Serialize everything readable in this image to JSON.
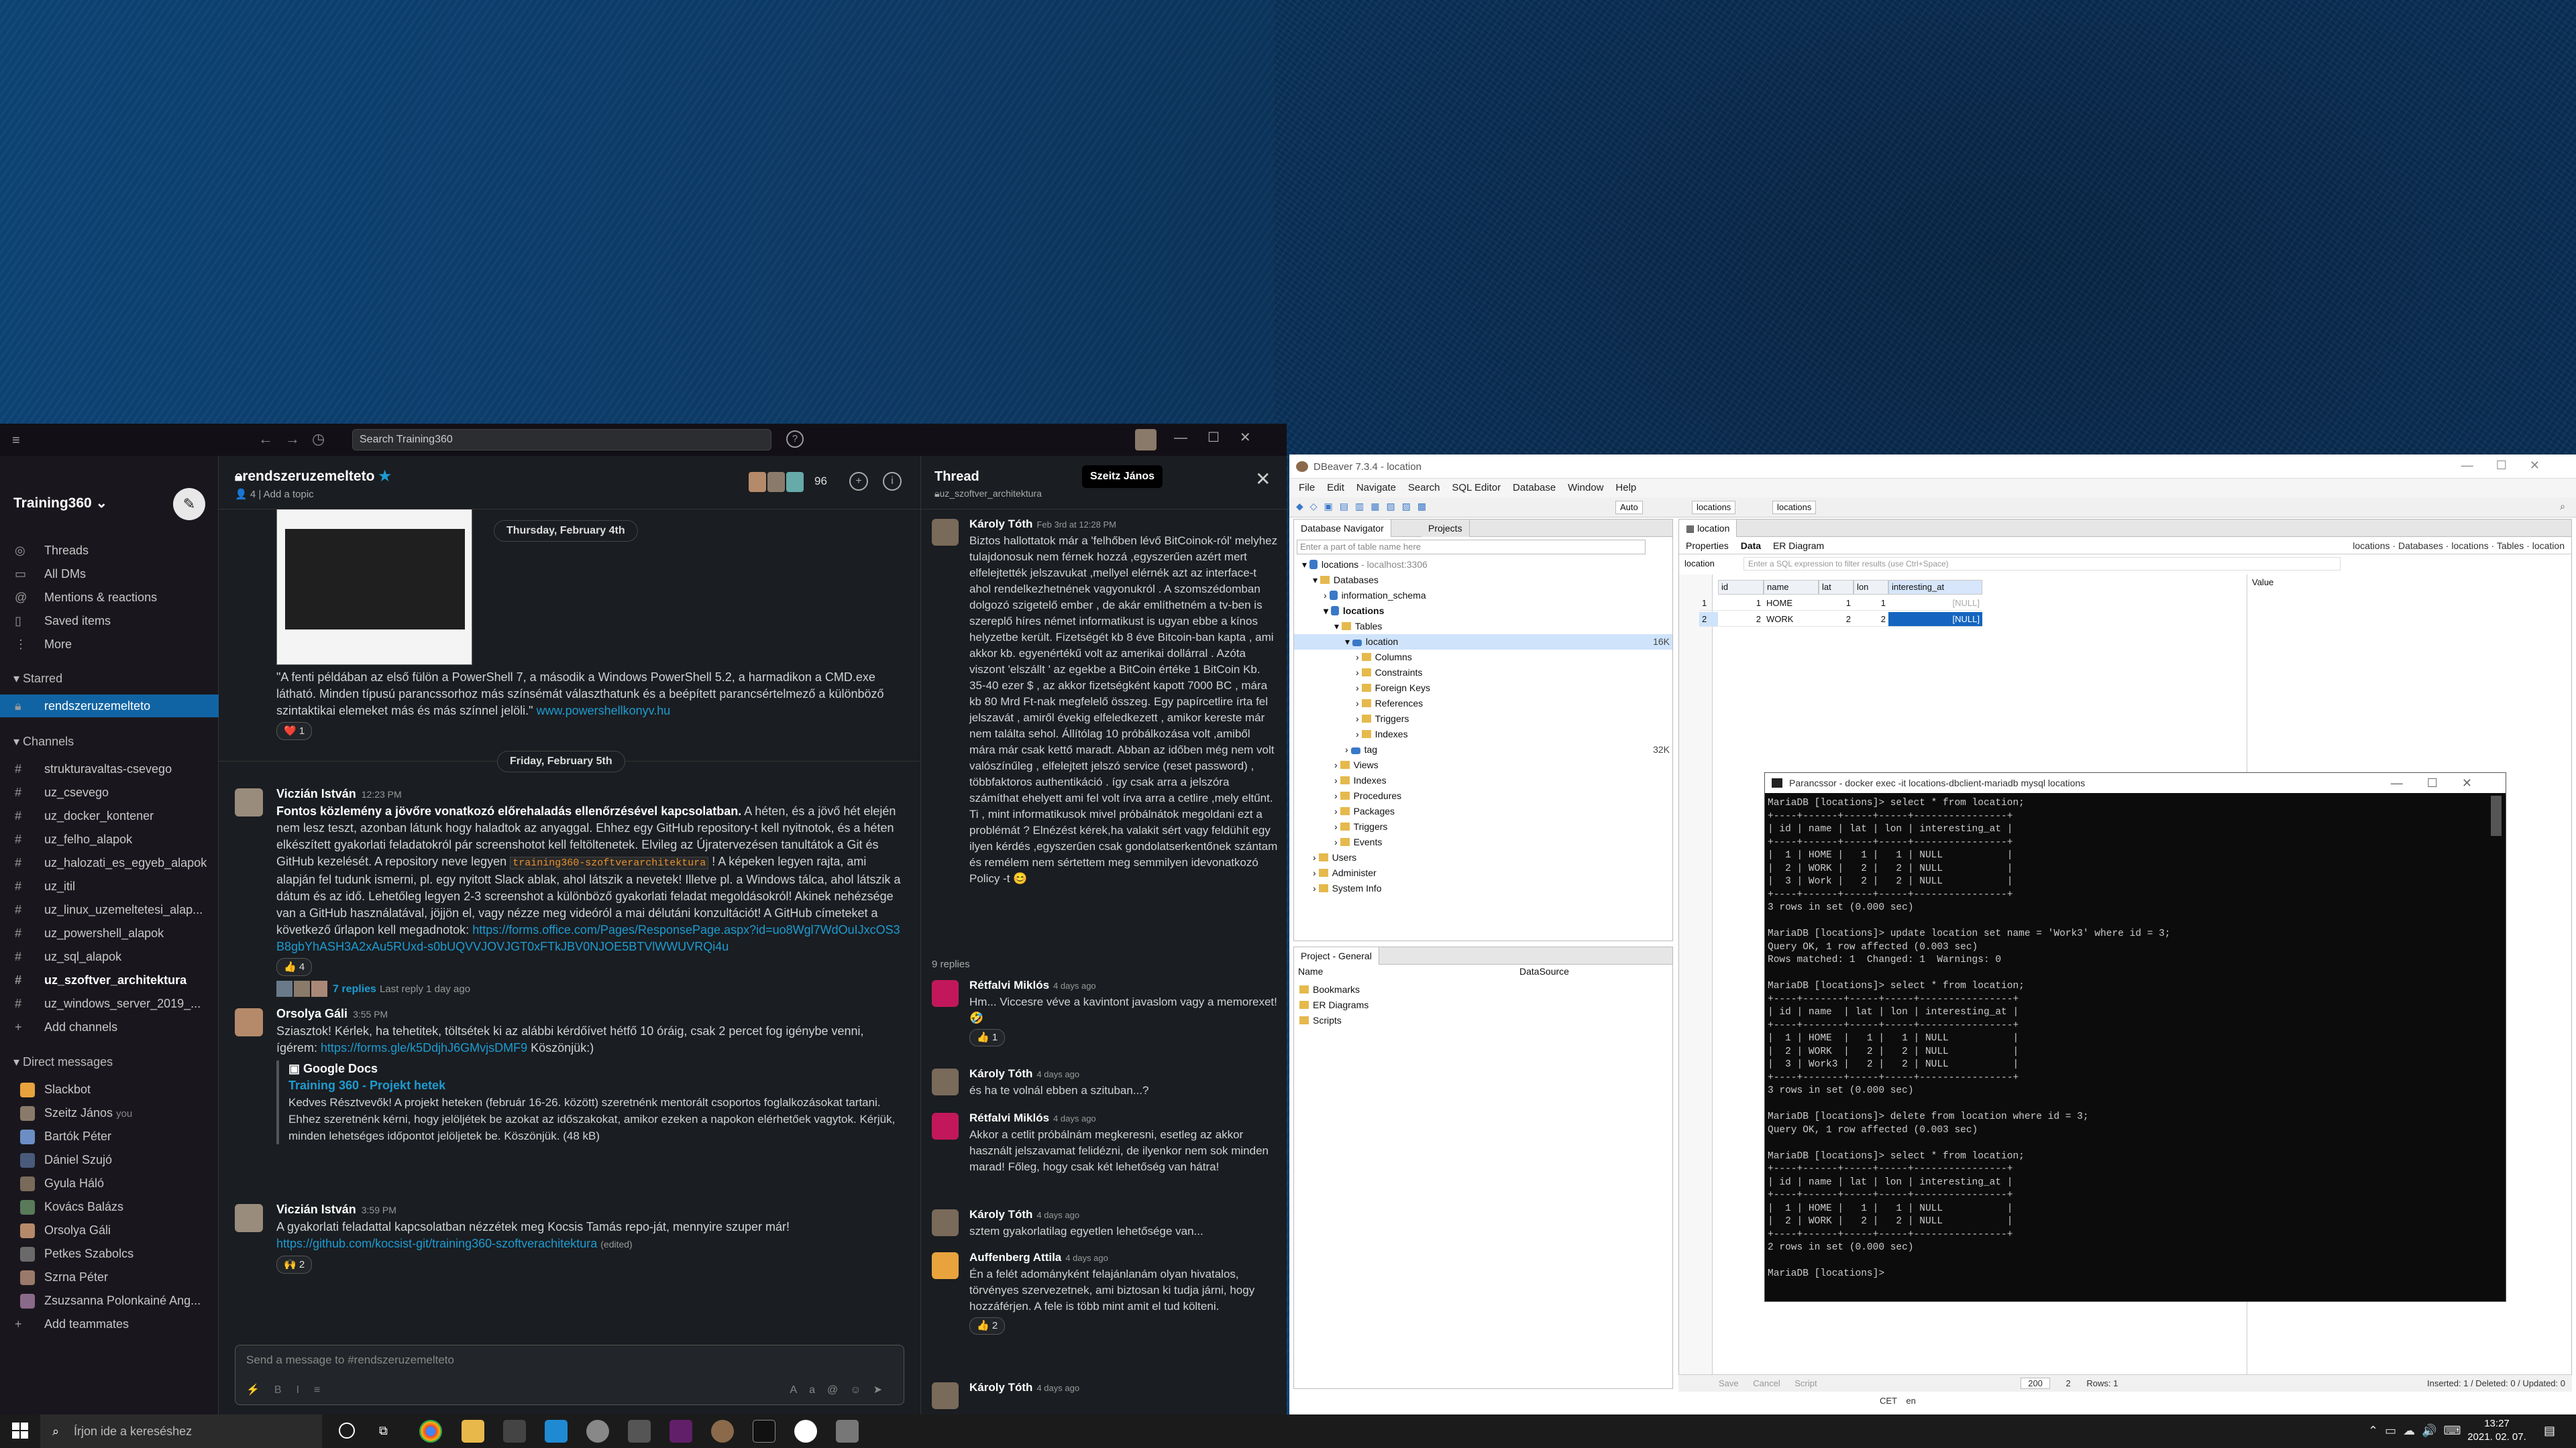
{
  "slack": {
    "search_placeholder": "Search Training360",
    "workspace": "Training360",
    "nav": [
      "Threads",
      "All DMs",
      "Mentions & reactions",
      "Saved items",
      "More"
    ],
    "starred_label": "Starred",
    "starred": [
      "rendszeruzemelteto"
    ],
    "channels_label": "Channels",
    "channels": [
      "strukturavaltas-csevego",
      "uz_csevego",
      "uz_docker_kontener",
      "uz_felho_alapok",
      "uz_halozati_es_egyeb_alapok",
      "uz_itil",
      "uz_linux_uzemeltetesi_alap...",
      "uz_powershell_alapok",
      "uz_sql_alapok",
      "uz_szoftver_architektura",
      "uz_windows_server_2019_..."
    ],
    "add_channels": "Add channels",
    "dm_label": "Direct messages",
    "dms": [
      "Slackbot",
      "Szeitz János",
      "Bartók Péter",
      "Dániel Szujó",
      "Gyula Háló",
      "Kovács Balázs",
      "Orsolya Gáli",
      "Petkes Szabolcs",
      "Szrna Péter",
      "Zsuzsanna Polonkainé Ang..."
    ],
    "dm_you": "you",
    "add_teammates": "Add teammates",
    "channel": {
      "name": "rendszeruzemelteto",
      "members_count_short": "4",
      "add_topic": "Add a topic",
      "member_count": "96",
      "date1": "Thursday, February 4th",
      "date2": "Friday, February 5th",
      "msg0_text": "\"A fenti példában az első fülön a PowerShell 7, a második a Windows PowerShell 5.2, a harmadikon a CMD.exe látható. Minden típusú parancssorhoz más színsémát választhatunk és a beépített parancsértelmező a különböző szintaktikai elemeket más és más színnel jelöli.\"",
      "msg0_link": "www.powershellkonyv.hu",
      "msg0_react": "❤️ 1",
      "msg1_name": "Viczián István",
      "msg1_time": "12:23 PM",
      "msg1_bold": "Fontos közlemény a jövőre vonatkozó előrehaladás ellenőrzésével kapcsolatban.",
      "msg1_text": "A héten, és a jövő hét elején nem lesz teszt, azonban látunk hogy haladtok az anyaggal. Ehhez egy GitHub repository-t kell nyitnotok, és a héten elkészített gyakorlati feladatokról pár screenshotot kell feltöltenetek. Elvileg az Újratervezésen tanultátok a Git és GitHub kezelését. A repository neve legyen",
      "msg1_code": "training360-szoftverarchitektura",
      "msg1_text2": "! A képeken legyen rajta, ami alapján fel tudunk ismerni, pl. egy nyitott Slack ablak, ahol látszik a nevetek! Illetve pl. a Windows tálca, ahol látszik a dátum és az idő. Lehetőleg legyen 2-3 screenshot a különböző gyakorlati feladat megoldásokról! Akinek nehézsége van a GitHub használatával, jöjjön el, vagy nézze meg videóról a mai délutáni konzultációt! A GitHub címeteket a következő űrlapon kell megadnotok:",
      "msg1_link": "https://forms.office.com/Pages/ResponsePage.aspx?id=uo8Wgl7WdOuIJxcOS3B8gbYhASH3A2xAu5RUxd-s0bUQVVJOVJGT0xFTkJBV0NJOE5BTVlWWUVRQi4u",
      "msg1_react": "👍 4",
      "msg1_replies": "7 replies",
      "msg1_last": "Last reply 1 day ago",
      "msg2_name": "Orsolya Gáli",
      "msg2_time": "3:55 PM",
      "msg2_text": "Sziasztok! Kérlek, ha tehetitek, töltsétek ki az alábbi kérdőívet hétfő 10 óráig, csak 2 percet fog igénybe venni, ígérem:",
      "msg2_link": "https://forms.gle/k5DdjhJ6GMvjsDMF9",
      "msg2_text2": "Köszönjük:)",
      "gd_source": "Google Docs",
      "gd_title": "Training 360 - Projekt hetek",
      "gd_text": "Kedves Résztvevők! A projekt heteken (február 16-26. között) szeretnénk mentorált csoportos foglalkozásokat tartani. Ehhez szeretnénk kérni, hogy jelöljétek be azokat az időszakokat, amikor ezeken a napokon elérhetőek vagytok. Kérjük, minden lehetséges időpontot jelöljetek be. Köszönjük. (48 kB)",
      "msg3_name": "Viczián István",
      "msg3_time": "3:59 PM",
      "msg3_text": "A gyakorlati feladattal kapcsolatban nézzétek meg Kocsis Tamás repo-ját, mennyire szuper már!",
      "msg3_link": "https://github.com/kocsist-git/training360-szoftverachitektura",
      "msg3_edited": "(edited)",
      "msg3_react": "🙌 2",
      "composer_placeholder": "Send a message to #rendszeruzemelteto"
    },
    "thread": {
      "title": "Thread",
      "channel": "uz_szoftver_architektura",
      "tooltip": "Szeitz János",
      "m0_name": "Károly Tóth",
      "m0_time": "Feb 3rd at 12:28 PM",
      "m0_text": "Biztos hallottatok már a 'felhőben lévő BitCoinok-ról' melyhez tulajdonosuk nem férnek hozzá ,egyszerűen azért mert elfelejtették jelszavukat ,mellyel elérnék azt az interface-t ahol rendelkezhetnének vagyonukról . A szomszédomban dolgozó szigetelő ember , de akár említhetném a tv-ben is szereplő híres német informatikust is ugyan ebbe a kínos helyzetbe került. Fizetségét kb 8 éve Bitcoin-ban kapta , ami akkor kb. egyenértékű volt az amerikai dollárral . Azóta viszont 'elszállt ' az egekbe a BitCoin értéke 1 BitCoin Kb. 35-40 ezer $ , az akkor fizetségként kapott 7000 BC , mára kb 80 Mrd Ft-nak megfelelő összeg. Egy papírcetlire írta fel jelszavát , amiről évekig elfeledkezett , amikor kereste már nem találta sehol. Állítólag 10 próbálkozása volt ,amiből mára már csak kettő maradt. Abban az időben még nem volt valószínűleg , elfelejtett jelszó service (reset password) , többfaktoros authentikáció . így csak arra a jelszóra számíthat ehelyett ami fel volt írva arra a cetlire ,mely eltűnt. Ti , mint informatikusok mivel próbálnátok megoldani ezt a problémát ? Elnézést kérek,ha valakit sért vagy feldühít egy ilyen kérdés ,egyszerűen csak gondolatserkentőnek szántam és remélem nem sértettem meg semmilyen idevonatkozó Policy -t 😊",
      "replies_label": "9 replies",
      "m1_name": "Rétfalvi Miklós",
      "m1_time": "4 days ago",
      "m1_text": "Hm... Viccesre véve a kavintont javaslom vagy a memorexet! 🤣",
      "m1_react": "👍 1",
      "m2_name": "Károly Tóth",
      "m2_time": "4 days ago",
      "m2_text": "és ha te volnál ebben a szituban...?",
      "m3_name": "Rétfalvi Miklós",
      "m3_time": "4 days ago",
      "m3_text": "Akkor a cetlit próbálnám megkeresni, esetleg az akkor használt jelszavamat felidézni, de ilyenkor nem sok minden marad! Főleg, hogy csak két lehetőség van hátra!",
      "m4_name": "Károly Tóth",
      "m4_time": "4 days ago",
      "m4_text": "sztem gyakorlatilag egyetlen lehetősége van...",
      "m5_name": "Auffenberg Attila",
      "m5_time": "4 days ago",
      "m5_text": "Én a felét adományként felajánlanám olyan hivatalos, törvényes szervezetnek, ami biztosan ki tudja járni, hogy hozzáférjen. A fele is több mint amit el tud költeni.",
      "m5_react": "👍 2",
      "m6_name": "Károly Tóth",
      "m6_time": "4 days ago"
    }
  },
  "dbeaver": {
    "title": "DBeaver 7.3.4 - location",
    "menu": [
      "File",
      "Edit",
      "Navigate",
      "Search",
      "SQL Editor",
      "Database",
      "Window",
      "Help"
    ],
    "toolbar_mode": "Auto",
    "toolbar_db": "locations",
    "toolbar_schema": "locations",
    "nav_tab": "Database Navigator",
    "projects_tab": "Projects",
    "filter_placeholder": "Enter a part of table name here",
    "tree": [
      {
        "label": "locations",
        "extra": "- localhost:3306"
      },
      {
        "label": "Databases"
      },
      {
        "label": "information_schema"
      },
      {
        "label": "locations"
      },
      {
        "label": "Tables"
      },
      {
        "label": "location",
        "size": "16K"
      },
      {
        "label": "Columns"
      },
      {
        "label": "Constraints"
      },
      {
        "label": "Foreign Keys"
      },
      {
        "label": "References"
      },
      {
        "label": "Triggers"
      },
      {
        "label": "Indexes"
      },
      {
        "label": "tag",
        "size": "32K"
      },
      {
        "label": "Views"
      },
      {
        "label": "Indexes"
      },
      {
        "label": "Procedures"
      },
      {
        "label": "Packages"
      },
      {
        "label": "Triggers"
      },
      {
        "label": "Events"
      },
      {
        "label": "Users"
      },
      {
        "label": "Administer"
      },
      {
        "label": "System Info"
      }
    ],
    "project_title": "Project - General",
    "project_cols": [
      "Name",
      "DataSource"
    ],
    "project_items": [
      "Bookmarks",
      "ER Diagrams",
      "Scripts"
    ],
    "editor_tab": "location",
    "subtabs": [
      "Properties",
      "Data",
      "ER Diagram"
    ],
    "breadcrumb": [
      "locations",
      "Databases",
      "locations",
      "Tables",
      "location"
    ],
    "filter_hint": "Enter a SQL expression to filter results (use Ctrl+Space)",
    "grid_cols": [
      "id",
      "name",
      "lat",
      "lon",
      "interesting_at"
    ],
    "grid_rows": [
      [
        "1",
        "1",
        "HOME",
        "1",
        "1",
        "[NULL]"
      ],
      [
        "2",
        "2",
        "WORK",
        "2",
        "2",
        "[NULL]"
      ]
    ],
    "value_panel": "Value",
    "status": {
      "save": "Save",
      "cancel": "Cancel",
      "script": "Script",
      "limit": "200",
      "count": "2",
      "rows": "Rows: 1",
      "summary": "Inserted: 1 / Deleted: 0 / Updated: 0",
      "tz": "CET",
      "lang": "en"
    }
  },
  "terminal": {
    "title": "Parancssor - docker  exec -it locations-dbclient-mariadb mysql locations",
    "text": "MariaDB [locations]> select * from location;\n+----+------+-----+-----+----------------+\n| id | name | lat | lon | interesting_at |\n+----+------+-----+-----+----------------+\n|  1 | HOME |   1 |   1 | NULL           |\n|  2 | WORK |   2 |   2 | NULL           |\n|  3 | Work |   2 |   2 | NULL           |\n+----+------+-----+-----+----------------+\n3 rows in set (0.000 sec)\n\nMariaDB [locations]> update location set name = 'Work3' where id = 3;\nQuery OK, 1 row affected (0.003 sec)\nRows matched: 1  Changed: 1  Warnings: 0\n\nMariaDB [locations]> select * from location;\n+----+-------+-----+-----+----------------+\n| id | name  | lat | lon | interesting_at |\n+----+-------+-----+-----+----------------+\n|  1 | HOME  |   1 |   1 | NULL           |\n|  2 | WORK  |   2 |   2 | NULL           |\n|  3 | Work3 |   2 |   2 | NULL           |\n+----+-------+-----+-----+----------------+\n3 rows in set (0.000 sec)\n\nMariaDB [locations]> delete from location where id = 3;\nQuery OK, 1 row affected (0.003 sec)\n\nMariaDB [locations]> select * from location;\n+----+------+-----+-----+----------------+\n| id | name | lat | lon | interesting_at |\n+----+------+-----+-----+----------------+\n|  1 | HOME |   1 |   1 | NULL           |\n|  2 | WORK |   2 |   2 | NULL           |\n+----+------+-----+-----+----------------+\n2 rows in set (0.000 sec)\n\nMariaDB [locations]> "
  },
  "taskbar": {
    "search": "Írjon ide a kereséshez",
    "time": "13:27",
    "date": "2021. 02. 07."
  }
}
